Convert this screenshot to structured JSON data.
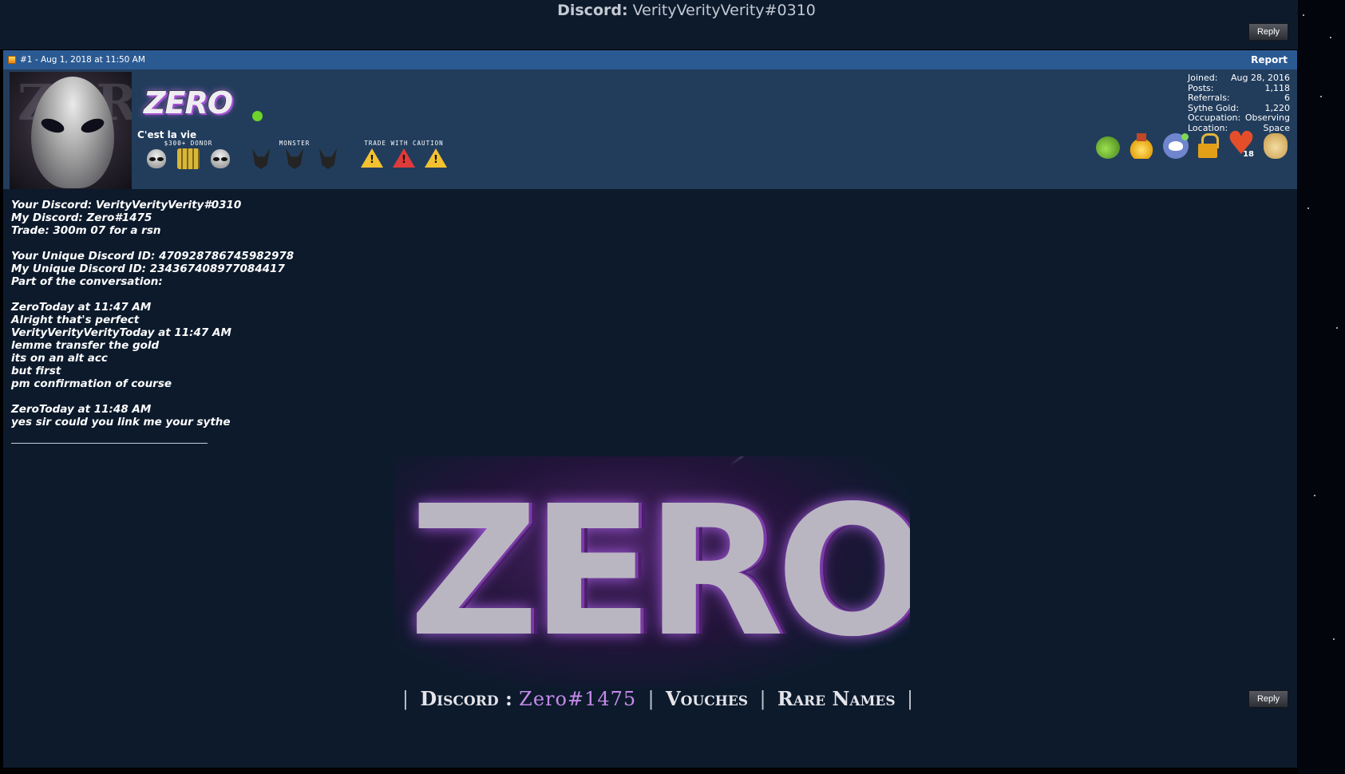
{
  "header": {
    "discord_key": "Discord:",
    "discord_value": "VerityVerityVerity#0310",
    "reply_label": "Reply"
  },
  "post": {
    "meta": "#1 - Aug 1, 2018 at 11:50 AM",
    "report_label": "Report"
  },
  "user": {
    "name": "ZERO",
    "title": "C'est la vie",
    "online_color": "#6ed22a",
    "badge_groups": [
      {
        "label": "$300+ DONOR",
        "icons": [
          "alien-icon",
          "money-icon",
          "alien-icon"
        ]
      },
      {
        "label": "MONSTER",
        "icons": [
          "horned-mask-icon",
          "horned-mask-icon",
          "horned-mask-icon"
        ]
      },
      {
        "label": "TRADE WITH CAUTION",
        "icons": [
          "warning-icon",
          "warning-red-icon",
          "warning-icon"
        ]
      }
    ],
    "stats": [
      {
        "label": "Joined:",
        "value": "Aug 28, 2016"
      },
      {
        "label": "Posts:",
        "value": "1,118"
      },
      {
        "label": "Referrals:",
        "value": "6"
      },
      {
        "label": "Sythe Gold:",
        "value": "1,220"
      },
      {
        "label": "Occupation:",
        "value": "Observing"
      },
      {
        "label": "Location:",
        "value": "Space"
      }
    ],
    "awards": [
      "potion-icon",
      "medal-icon",
      "discord-icon",
      "lock-icon",
      "heart-icon",
      "doge-icon"
    ],
    "heart_count": "18"
  },
  "message": {
    "lines": [
      "Your Discord: VerityVerityVerity#0310",
      "My Discord: Zero#1475",
      "Trade: 300m 07 for a rsn",
      "",
      "Your Unique Discord ID: 470928786745982978",
      "My Unique Discord ID: 234367408977084417",
      "Part of the conversation:",
      "",
      "ZeroToday at 11:47 AM",
      "Alright that's perfect",
      "VerityVerityVerityToday at 11:47 AM",
      "lemme transfer the gold",
      "its on an alt acc",
      "but first",
      "pm confirmation of course",
      "",
      "ZeroToday at 11:48 AM",
      "yes sir could you link me your sythe"
    ]
  },
  "signature": {
    "banner_text": "ZERO",
    "discord_label": "Discord :",
    "discord_value": "Zero#1475",
    "vouches_label": "Vouches",
    "rare_names_label": "Rare Names",
    "separator": "|"
  },
  "colors": {
    "page_bg": "#0c1a2c",
    "post_bar": "#2b5a93",
    "user_panel": "#223d5c",
    "accent_purple": "#c58ae9"
  }
}
